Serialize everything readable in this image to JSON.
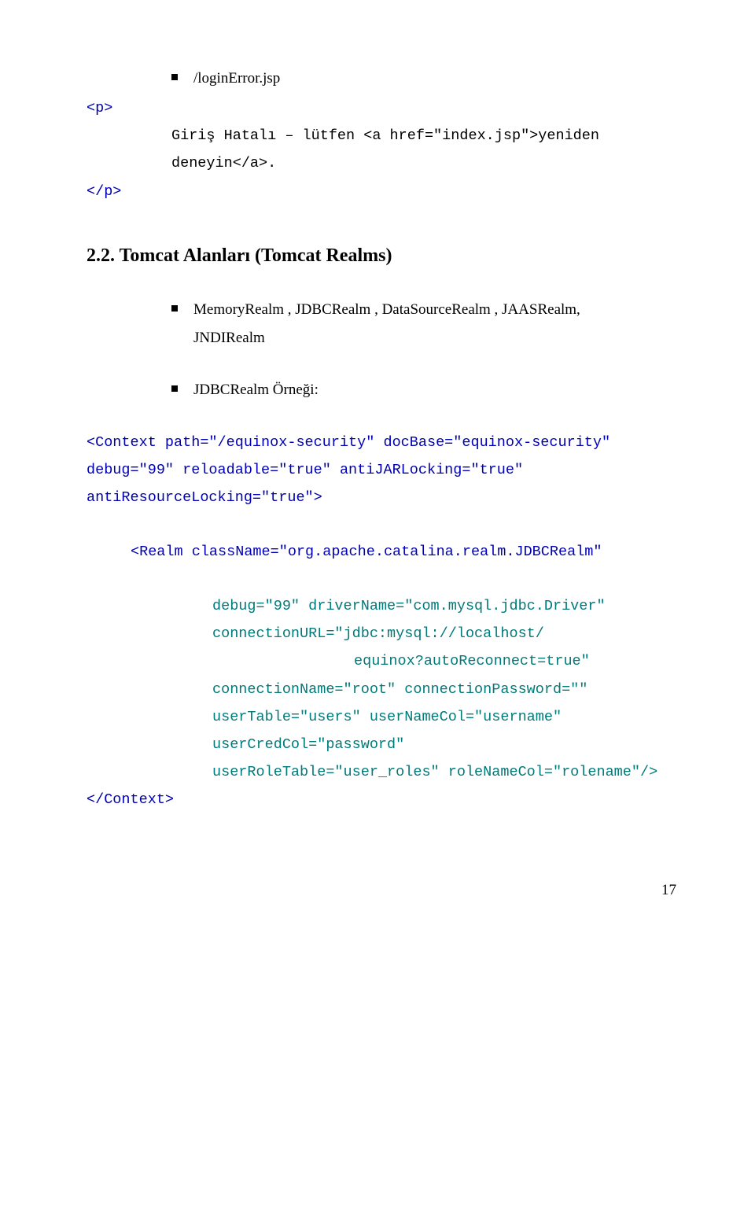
{
  "top": {
    "bullet1": "/loginError.jsp",
    "p_open": "<p>",
    "line1": "Giriş Hatalı – lütfen <a href=\"index.jsp\">yeniden",
    "line2": "deneyin</a>.",
    "p_close": "</p>"
  },
  "section": {
    "number": "2.2.",
    "title": "Tomcat Alanları (Tomcat Realms)"
  },
  "bullets": {
    "realm_list1": "MemoryRealm , JDBCRealm , DataSourceRealm , JAASRealm,",
    "realm_list2": "JNDIRealm",
    "example": "JDBCRealm Örneği:"
  },
  "code": {
    "l1": "<Context path=\"/equinox-security\" docBase=\"equinox-security\"",
    "l2": "debug=\"99\" reloadable=\"true\" antiJARLocking=\"true\"",
    "l3": "antiResourceLocking=\"true\">",
    "l4": "<Realm className=\"org.apache.catalina.realm.JDBCRealm\"",
    "l5": "debug=\"99\" driverName=\"com.mysql.jdbc.Driver\"",
    "l6": "connectionURL=\"jdbc:mysql://localhost/",
    "l7": "equinox?autoReconnect=true\"",
    "l8": "connectionName=\"root\" connectionPassword=\"\"",
    "l9": "userTable=\"users\" userNameCol=\"username\"",
    "l10": "userCredCol=\"password\"",
    "l11": "userRoleTable=\"user_roles\" roleNameCol=\"rolename\"/>",
    "l12": "</Context>"
  },
  "page_number": "17"
}
